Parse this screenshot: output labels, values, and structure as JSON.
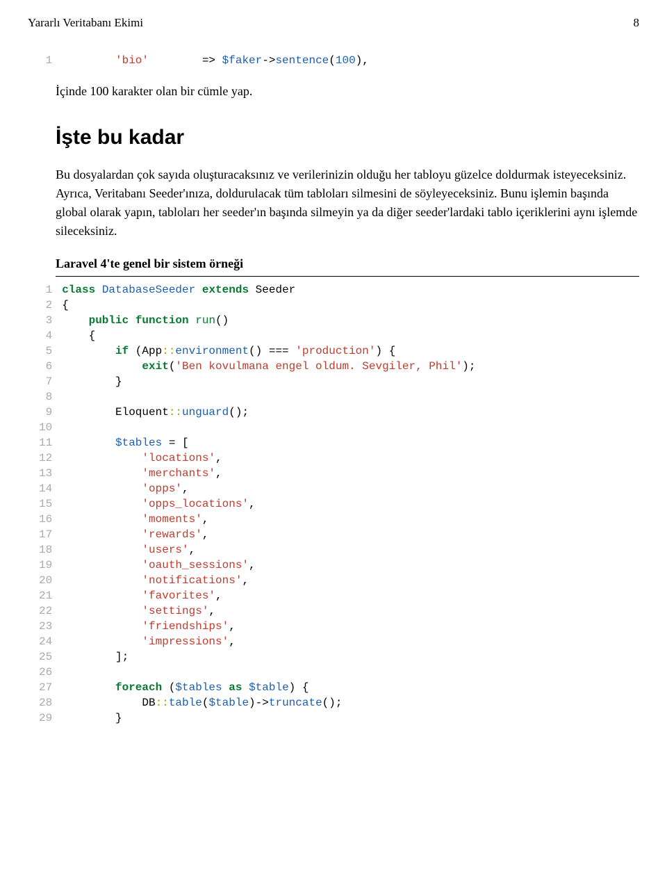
{
  "header": {
    "title": "Yararlı Veritabanı Ekimi",
    "page": "8"
  },
  "code1": {
    "lines": [
      "1"
    ],
    "tokens": [
      [
        [
          "        ",
          " "
        ],
        [
          "'bio'",
          "str"
        ],
        [
          "        ",
          " "
        ],
        [
          "=> ",
          "op"
        ],
        [
          "$faker",
          "var"
        ],
        [
          "->",
          "op"
        ],
        [
          "sentence",
          "var"
        ],
        [
          "(",
          "op"
        ],
        [
          "100",
          "var"
        ],
        [
          "),",
          "op"
        ]
      ]
    ]
  },
  "p1": "İçinde 100 karakter olan bir cümle yap.",
  "h2": "İşte bu kadar",
  "p2": "Bu dosyalardan çok sayıda oluşturacaksınız ve verilerinizin olduğu her tabloyu güzelce doldurmak isteyeceksiniz. Ayrıca, Veritabanı Seeder'ınıza, doldurulacak tüm tabloları silmesini de söyleyeceksiniz. Bunu işlemin başında global olarak yapın, tabloları her seeder'ın başında silmeyin ya da diğer seeder'lardaki tablo içeriklerini aynı işlemde sileceksiniz.",
  "bold": "Laravel 4'te genel bir sistem örneği",
  "code2": {
    "lines": [
      "1",
      "2",
      "3",
      "4",
      "5",
      "6",
      "7",
      "8",
      "9",
      "10",
      "11",
      "12",
      "13",
      "14",
      "15",
      "16",
      "17",
      "18",
      "19",
      "20",
      "21",
      "22",
      "23",
      "24",
      "25",
      "26",
      "27",
      "28",
      "29"
    ],
    "tokens": [
      [
        [
          "class",
          "kw"
        ],
        [
          " ",
          " "
        ],
        [
          "DatabaseSeeder",
          "type"
        ],
        [
          " ",
          " "
        ],
        [
          "extends",
          "kw"
        ],
        [
          " ",
          " "
        ],
        [
          "Seeder",
          "op"
        ]
      ],
      [
        [
          "{",
          "op"
        ]
      ],
      [
        [
          "    ",
          " "
        ],
        [
          "public",
          "kw"
        ],
        [
          " ",
          " "
        ],
        [
          "function",
          "kw"
        ],
        [
          " ",
          " "
        ],
        [
          "run",
          "fn"
        ],
        [
          "()",
          "op"
        ]
      ],
      [
        [
          "    {",
          "op"
        ]
      ],
      [
        [
          "        ",
          " "
        ],
        [
          "if",
          "kw"
        ],
        [
          " (",
          "op"
        ],
        [
          "App",
          "op"
        ],
        [
          "::",
          "scope"
        ],
        [
          "environment",
          "var"
        ],
        [
          "() === ",
          "op"
        ],
        [
          "'production'",
          "str"
        ],
        [
          ") {",
          "op"
        ]
      ],
      [
        [
          "            ",
          " "
        ],
        [
          "exit",
          "kw"
        ],
        [
          "(",
          "op"
        ],
        [
          "'Ben kovulmana engel oldum. Sevgiler, Phil'",
          "str"
        ],
        [
          ");",
          "op"
        ]
      ],
      [
        [
          "        }",
          "op"
        ]
      ],
      [
        [
          "",
          ""
        ]
      ],
      [
        [
          "        ",
          " "
        ],
        [
          "Eloquent",
          "op"
        ],
        [
          "::",
          "scope"
        ],
        [
          "unguard",
          "var"
        ],
        [
          "();",
          "op"
        ]
      ],
      [
        [
          "",
          ""
        ]
      ],
      [
        [
          "        ",
          " "
        ],
        [
          "$tables",
          "var"
        ],
        [
          " = [",
          "op"
        ]
      ],
      [
        [
          "            ",
          " "
        ],
        [
          "'locations'",
          "str"
        ],
        [
          ",",
          "op"
        ]
      ],
      [
        [
          "            ",
          " "
        ],
        [
          "'merchants'",
          "str"
        ],
        [
          ",",
          "op"
        ]
      ],
      [
        [
          "            ",
          " "
        ],
        [
          "'opps'",
          "str"
        ],
        [
          ",",
          "op"
        ]
      ],
      [
        [
          "            ",
          " "
        ],
        [
          "'opps_locations'",
          "str"
        ],
        [
          ",",
          "op"
        ]
      ],
      [
        [
          "            ",
          " "
        ],
        [
          "'moments'",
          "str"
        ],
        [
          ",",
          "op"
        ]
      ],
      [
        [
          "            ",
          " "
        ],
        [
          "'rewards'",
          "str"
        ],
        [
          ",",
          "op"
        ]
      ],
      [
        [
          "            ",
          " "
        ],
        [
          "'users'",
          "str"
        ],
        [
          ",",
          "op"
        ]
      ],
      [
        [
          "            ",
          " "
        ],
        [
          "'oauth_sessions'",
          "str"
        ],
        [
          ",",
          "op"
        ]
      ],
      [
        [
          "            ",
          " "
        ],
        [
          "'notifications'",
          "str"
        ],
        [
          ",",
          "op"
        ]
      ],
      [
        [
          "            ",
          " "
        ],
        [
          "'favorites'",
          "str"
        ],
        [
          ",",
          "op"
        ]
      ],
      [
        [
          "            ",
          " "
        ],
        [
          "'settings'",
          "str"
        ],
        [
          ",",
          "op"
        ]
      ],
      [
        [
          "            ",
          " "
        ],
        [
          "'friendships'",
          "str"
        ],
        [
          ",",
          "op"
        ]
      ],
      [
        [
          "            ",
          " "
        ],
        [
          "'impressions'",
          "str"
        ],
        [
          ",",
          "op"
        ]
      ],
      [
        [
          "        ];",
          "op"
        ]
      ],
      [
        [
          "",
          ""
        ]
      ],
      [
        [
          "        ",
          " "
        ],
        [
          "foreach",
          "kw"
        ],
        [
          " (",
          "op"
        ],
        [
          "$tables",
          "var"
        ],
        [
          " ",
          " "
        ],
        [
          "as",
          "kw"
        ],
        [
          " ",
          " "
        ],
        [
          "$table",
          "var"
        ],
        [
          ") {",
          "op"
        ]
      ],
      [
        [
          "            ",
          " "
        ],
        [
          "DB",
          "op"
        ],
        [
          "::",
          "scope"
        ],
        [
          "table",
          "var"
        ],
        [
          "(",
          "op"
        ],
        [
          "$table",
          "var"
        ],
        [
          ")->",
          "op"
        ],
        [
          "truncate",
          "var"
        ],
        [
          "();",
          "op"
        ]
      ],
      [
        [
          "        }",
          "op"
        ]
      ]
    ]
  }
}
